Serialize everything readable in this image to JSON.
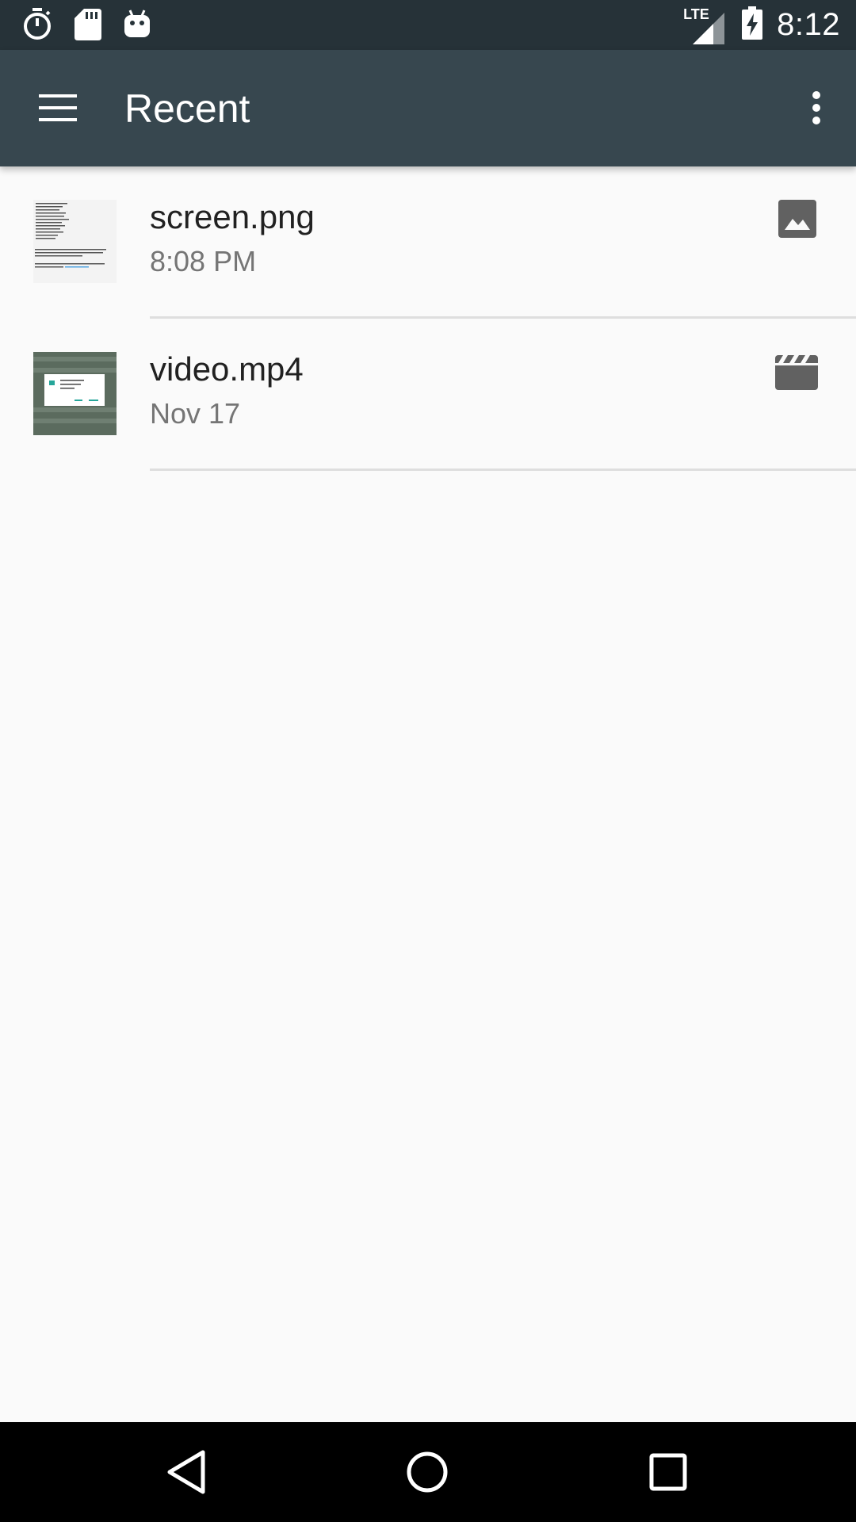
{
  "status_bar": {
    "time": "8:12",
    "network": "LTE",
    "left_icons": [
      "stopwatch-icon",
      "sd-card-icon",
      "android-icon"
    ]
  },
  "app_bar": {
    "title": "Recent"
  },
  "files": [
    {
      "name": "screen.png",
      "date": "8:08 PM",
      "type_icon": "image-icon"
    },
    {
      "name": "video.mp4",
      "date": "Nov 17",
      "type_icon": "movie-icon"
    }
  ],
  "colors": {
    "status_bar": "#263238",
    "app_bar": "#37474f",
    "background": "#fafafa",
    "type_icon": "#616161"
  }
}
